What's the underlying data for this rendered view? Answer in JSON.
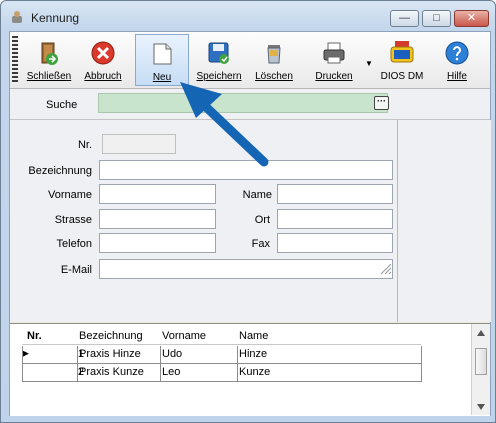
{
  "window": {
    "title": "Kennung",
    "controls": {
      "minimize": "—",
      "maximize": "□",
      "close": "✕"
    }
  },
  "toolbar": {
    "buttons": [
      {
        "label": "Schließen",
        "icon": "close-door-icon"
      },
      {
        "label": "Abbruch",
        "icon": "cancel-icon"
      },
      {
        "label": "Neu",
        "icon": "new-document-icon"
      },
      {
        "label": "Speichern",
        "icon": "save-icon"
      },
      {
        "label": "Löschen",
        "icon": "trash-icon"
      },
      {
        "label": "Drucken",
        "icon": "printer-icon"
      },
      {
        "label": "DIOS DM",
        "icon": "qm-pdf-icon"
      },
      {
        "label": "Hilfe",
        "icon": "help-icon"
      }
    ],
    "dropdown_arrow": "▼"
  },
  "search": {
    "label": "Suche",
    "value": "",
    "button": "···"
  },
  "form": {
    "nr_label": "Nr.",
    "nr_value": "",
    "bezeichnung_label": "Bezeichnung",
    "bezeichnung_value": "",
    "vorname_label": "Vorname",
    "vorname_value": "",
    "name_label": "Name",
    "name_value": "",
    "strasse_label": "Strasse",
    "strasse_value": "",
    "ort_label": "Ort",
    "ort_value": "",
    "telefon_label": "Telefon",
    "telefon_value": "",
    "fax_label": "Fax",
    "fax_value": "",
    "email_label": "E-Mail",
    "email_value": ""
  },
  "grid": {
    "columns": [
      "Nr.",
      "Bezeichnung",
      "Vorname",
      "Name"
    ],
    "rows": [
      {
        "nr": "1",
        "bezeichnung": "Praxis Hinze",
        "vorname": "Udo",
        "name": "Hinze"
      },
      {
        "nr": "2",
        "bezeichnung": "Praxis Kunze",
        "vorname": "Leo",
        "name": "Kunze"
      }
    ],
    "current_row_marker": "▶"
  },
  "colors": {
    "arrow": "#1565b5",
    "search_bg": "#c9e4cc",
    "active_button": "#c6dcf5"
  }
}
